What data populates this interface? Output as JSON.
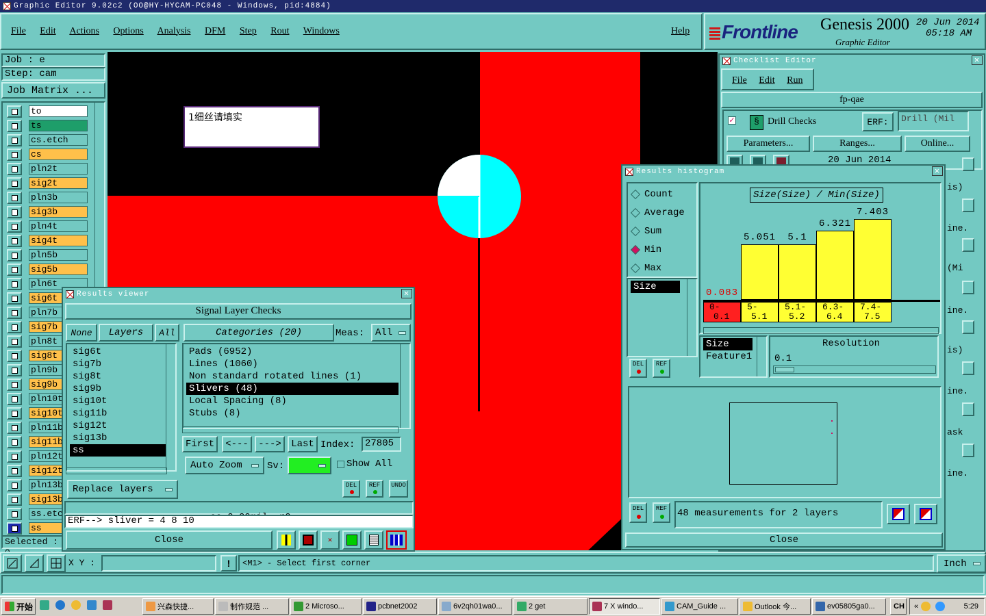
{
  "window_title": "Graphic Editor 9.02c2 (OO@HY-HYCAM-PC048 - Windows, pid:4884)",
  "menubar": {
    "items": [
      "File",
      "Edit",
      "Actions",
      "Options",
      "Analysis",
      "DFM",
      "Step",
      "Rout",
      "Windows"
    ],
    "help": "Help"
  },
  "brand": {
    "logo": "Frontline",
    "product": "Genesis 2000",
    "subtitle": "Graphic Editor",
    "date": "20 Jun 2014",
    "time": "05:18 AM"
  },
  "job": {
    "job_line": "Job : e",
    "step_line": "Step: cam",
    "matrix_button": "Job Matrix ...",
    "selected_label": "Selected : 0"
  },
  "layers": [
    "to",
    "ts",
    "cs.etch",
    "cs",
    "pln2t",
    "sig2t",
    "pln3b",
    "sig3b",
    "pln4t",
    "sig4t",
    "pln5b",
    "sig5b",
    "pln6t",
    "sig6t",
    "pln7b",
    "sig7b",
    "pln8t",
    "sig8t",
    "pln9b",
    "sig9b",
    "pln10t",
    "sig10t",
    "pln11b",
    "sig11b",
    "pln12t",
    "sig12t",
    "pln13b",
    "sig13b",
    "ss.etch",
    "ss"
  ],
  "canvas": {
    "note": "1细丝请填实"
  },
  "statusbar": {
    "xy_label": "X Y :",
    "prompt": "<M1> - Select first corner",
    "units": "Inch"
  },
  "results_viewer": {
    "title": "Results viewer",
    "heading": "Signal Layer Checks",
    "none_button": "None",
    "layers_button": "Layers",
    "all_button": "All",
    "categories_button": "Categories (20)",
    "meas_label": "Meas:",
    "meas_value": "All",
    "layer_list": [
      "sig6t",
      "sig7b",
      "sig8t",
      "sig9b",
      "sig10t",
      "sig11b",
      "sig12t",
      "sig13b",
      "ss"
    ],
    "categories": [
      "Pads (6952)",
      "Lines (1060)",
      "Non standard rotated lines (1)",
      "Slivers (48)",
      "Local Spacing (8)",
      "Stubs (8)"
    ],
    "first": "First",
    "prev": "<---",
    "next": "--->",
    "last": "Last",
    "index_label": "Index:",
    "index_value": "27805",
    "zoom_button": "Auto Zoom",
    "sv_label": "Sv:",
    "show_all": "Show All",
    "replace_button": "Replace layers",
    "del": "DEL",
    "ref": "REF",
    "undo": "UNDO",
    "info_line": "ss 0.09mil  r0",
    "erf_line": "ERF--> sliver = 4 8 10",
    "close": "Close"
  },
  "checklist_editor": {
    "title": "Checklist Editor",
    "menu": [
      "File",
      "Edit",
      "Run"
    ],
    "name": "fp-qae",
    "check_name": "Drill Checks",
    "erf_label": "ERF:",
    "erf_value": "Drill (Mil",
    "params_button": "Parameters...",
    "ranges_button": "Ranges...",
    "online_button": "Online...",
    "date": "20 Jun 2014",
    "side_fragments": [
      "is)",
      "ine...",
      "(Mi",
      "ine...",
      "is)",
      "ine...",
      "ask",
      "ine..."
    ]
  },
  "histogram": {
    "title": "Results histogram",
    "modes": [
      "Count",
      "Average",
      "Sum",
      "Min",
      "Max"
    ],
    "selected_mode": "Min",
    "attr_list": [
      "Size"
    ],
    "chart_title": "Size(Size) / Min(Size)",
    "chart_data": {
      "type": "bar",
      "title": "Size(Size) / Min(Size)",
      "categories": [
        "0-0.1",
        "5-5.1",
        "5.1-5.2",
        "6.3-6.4",
        "7.4-7.5"
      ],
      "values": [
        0.083,
        5.051,
        5.1,
        6.321,
        7.403
      ],
      "value_labels": [
        "0.083",
        "5.051",
        "5.1",
        "6.321",
        "7.403"
      ],
      "range_top": [
        "0-",
        "5-",
        "5.1-",
        "6.3-",
        "7.4-"
      ],
      "range_bottom": [
        "0.1",
        "5.1",
        "5.2",
        "6.4",
        "7.5"
      ],
      "ylim": [
        0,
        7.403
      ]
    },
    "field_list": [
      "Size",
      "Feature1"
    ],
    "resolution_label": "Resolution",
    "resolution_value": "0.1",
    "measurements": "48 measurements for 2 layers",
    "del": "DEL",
    "ref": "REF",
    "close": "Close"
  },
  "taskbar": {
    "start": "开始",
    "items": [
      "兴森快捷...",
      "制作规范 ...",
      "2 Microso...",
      "pcbnet2002",
      "6v2qh01wa0...",
      "2 get",
      "7 X windo...",
      "CAM_Guide ...",
      "Outlook 今...",
      "ev05805ga0..."
    ],
    "lang": "CH",
    "clock": "5:29"
  },
  "colors": {
    "panel": "#73c9c2",
    "copper": "#ff0000",
    "highlight": "#00ffff",
    "bar": "#ffff33",
    "layer_active": "#ffc04a",
    "layer_green": "#1e9e6a",
    "range_red": "#ff2020"
  }
}
